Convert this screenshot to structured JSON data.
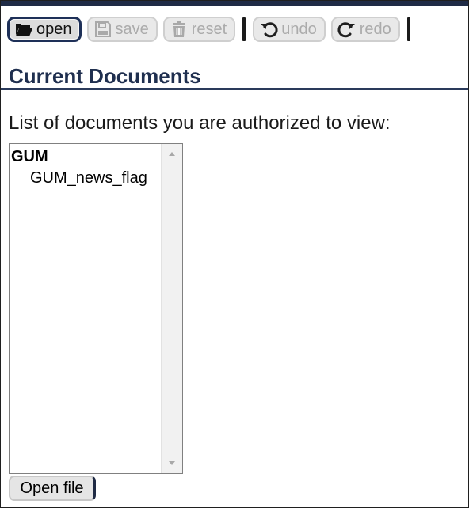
{
  "toolbar": {
    "buttons": [
      {
        "label": "open",
        "icon": "folder-open-icon",
        "state": "active"
      },
      {
        "label": "save",
        "icon": "floppy-disk-icon",
        "state": "disabled"
      },
      {
        "label": "reset",
        "icon": "trash-icon",
        "state": "disabled"
      },
      {
        "label": "undo",
        "icon": "undo-icon",
        "state": "disabled"
      },
      {
        "label": "redo",
        "icon": "redo-icon",
        "state": "disabled"
      }
    ]
  },
  "section": {
    "title": "Current Documents",
    "intro": "List of documents you are authorized to view:"
  },
  "document_list": {
    "group": "GUM",
    "items": [
      "GUM_news_flag"
    ]
  },
  "actions": {
    "open_file_label": "Open file"
  },
  "colors": {
    "header_navy": "#1f2b46",
    "title_blue": "#1f2f4f",
    "active_border": "#1e3058",
    "disabled_text": "#ababab",
    "list_border": "#808080",
    "scrollbar_bg": "#f1f1f1"
  }
}
